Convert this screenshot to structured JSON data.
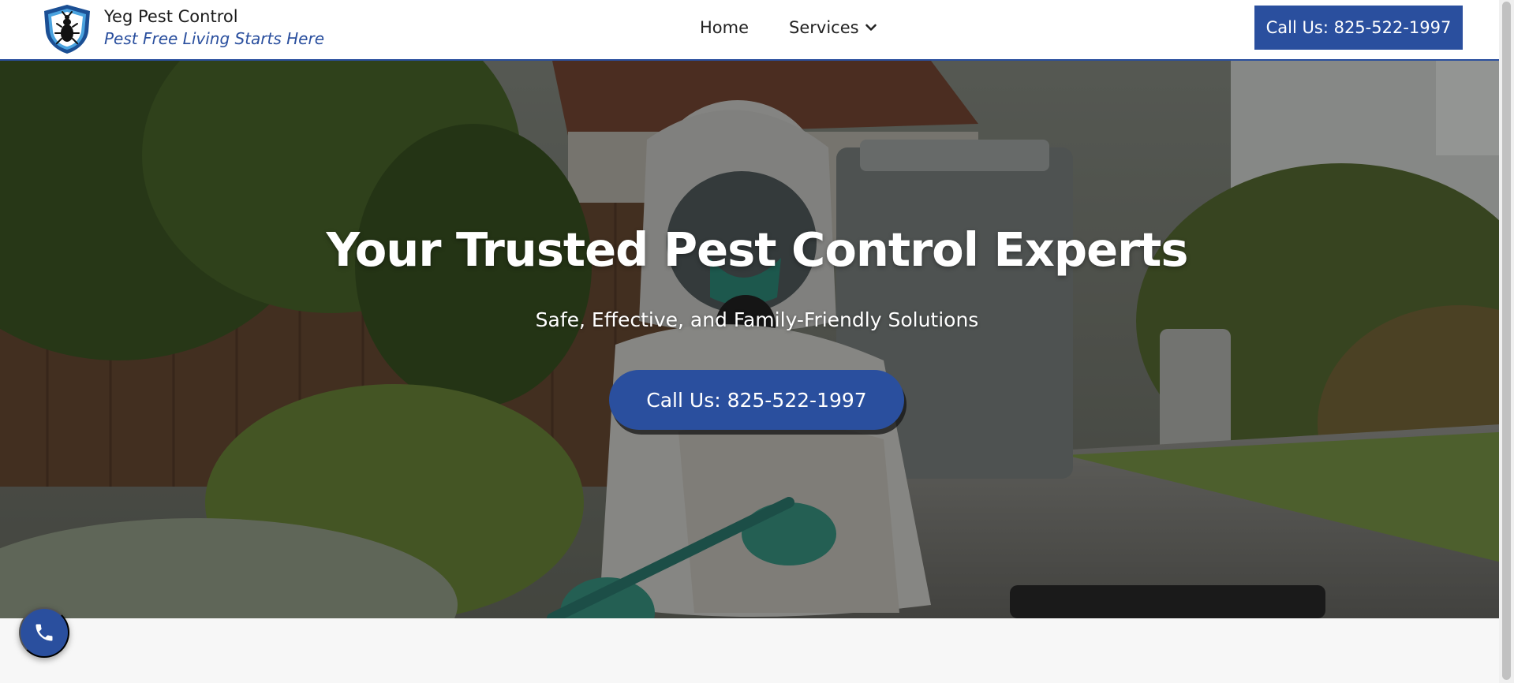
{
  "header": {
    "brand_name": "Yeg Pest Control",
    "brand_tagline": "Pest Free Living Starts Here",
    "logo_icon": "shield-bug-icon",
    "nav": [
      {
        "label": "Home"
      },
      {
        "label": "Services",
        "icon": "chevron-down-icon"
      }
    ],
    "cta_label": "Call Us: 825-522-1997"
  },
  "hero": {
    "title": "Your Trusted Pest Control Experts",
    "subtitle": "Safe, Effective, and Family-Friendly Solutions",
    "cta_label": "Call Us: 825-522-1997"
  },
  "floating_button": {
    "icon": "phone-icon"
  },
  "colors": {
    "brand_blue": "#2a4f9e",
    "header_bg": "#ffffff",
    "text_dark": "#1b1b1b",
    "page_bg": "#f7f7f7"
  }
}
